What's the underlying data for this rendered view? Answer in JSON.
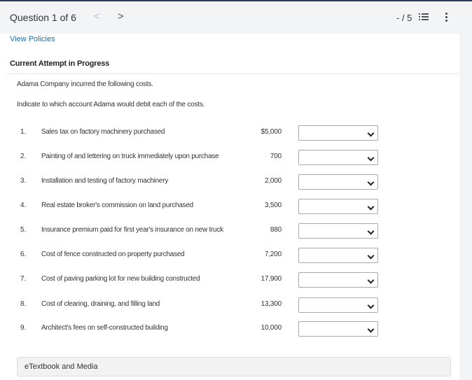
{
  "header": {
    "question_label": "Question 1 of 6",
    "prev_glyph": "<",
    "next_glyph": ">",
    "score": "- / 5"
  },
  "links": {
    "view_policies": "View Policies"
  },
  "section": {
    "current_attempt": "Current Attempt in Progress"
  },
  "question": {
    "intro": "Adama Company incurred the following costs.",
    "instruction": "Indicate to which account Adama would debit each of the costs."
  },
  "costs": [
    {
      "num": "1.",
      "desc": "Sales tax on factory machinery purchased",
      "amount": "$5,000",
      "selected": ""
    },
    {
      "num": "2.",
      "desc": "Painting of and lettering on truck immediately upon purchase",
      "amount": "700",
      "selected": ""
    },
    {
      "num": "3.",
      "desc": "Installation and testing of factory machinery",
      "amount": "2,000",
      "selected": ""
    },
    {
      "num": "4.",
      "desc": "Real estate broker's commission on land purchased",
      "amount": "3,500",
      "selected": ""
    },
    {
      "num": "5.",
      "desc": "Insurance premium paid for first year's insurance on new truck",
      "amount": "880",
      "selected": ""
    },
    {
      "num": "6.",
      "desc": "Cost of fence constructed on property purchased",
      "amount": "7,200",
      "selected": ""
    },
    {
      "num": "7.",
      "desc": "Cost of paving parking lot for new building constructed",
      "amount": "17,900",
      "selected": ""
    },
    {
      "num": "8.",
      "desc": "Cost of clearing, draining, and filling land",
      "amount": "13,300",
      "selected": ""
    },
    {
      "num": "9.",
      "desc": "Architect's fees on self-constructed building",
      "amount": "10,000",
      "selected": ""
    }
  ],
  "footer": {
    "etextbook": "eTextbook and Media"
  },
  "icons": {
    "list": "list-icon",
    "more": "more-vertical-icon",
    "chevron": "chevron-down-icon"
  },
  "colors": {
    "link": "#1a6fa8",
    "top_border": "#2a3a55"
  }
}
